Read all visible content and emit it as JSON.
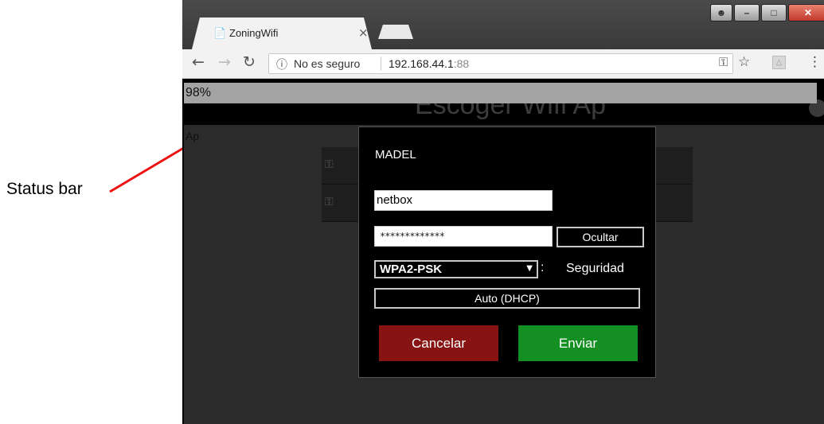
{
  "annotation": {
    "label": "Status bar",
    "arrow_color": "#ee1111"
  },
  "browser": {
    "tab_title": "ZoningWifi",
    "security_text": "No es seguro",
    "url_host": "192.168.44.1",
    "url_port": ":88",
    "icons": {
      "back": "back-arrow-icon",
      "forward": "forward-arrow-icon",
      "reload": "reload-icon",
      "info": "info-icon",
      "key": "key-icon",
      "star": "star-icon",
      "menu": "menu-dots-icon"
    }
  },
  "page": {
    "status_text": "98%",
    "header_title": "Escoger Wifi Ap",
    "side_label": "Ap",
    "colors": {
      "header": "#000000",
      "status_bar": "#a3a3a3",
      "background": "#2b2b2b"
    }
  },
  "dialog": {
    "title": "MADEL",
    "ssid_value": "netbox",
    "password_value": "*************",
    "toggle_label": "Ocultar",
    "security_value": "WPA2-PSK",
    "security_colon": ":",
    "security_label": "Seguridad",
    "ip_mode_label": "Auto (DHCP)",
    "cancel_label": "Cancelar",
    "submit_label": "Enviar",
    "colors": {
      "cancel": "#871313",
      "submit": "#148f22"
    }
  }
}
